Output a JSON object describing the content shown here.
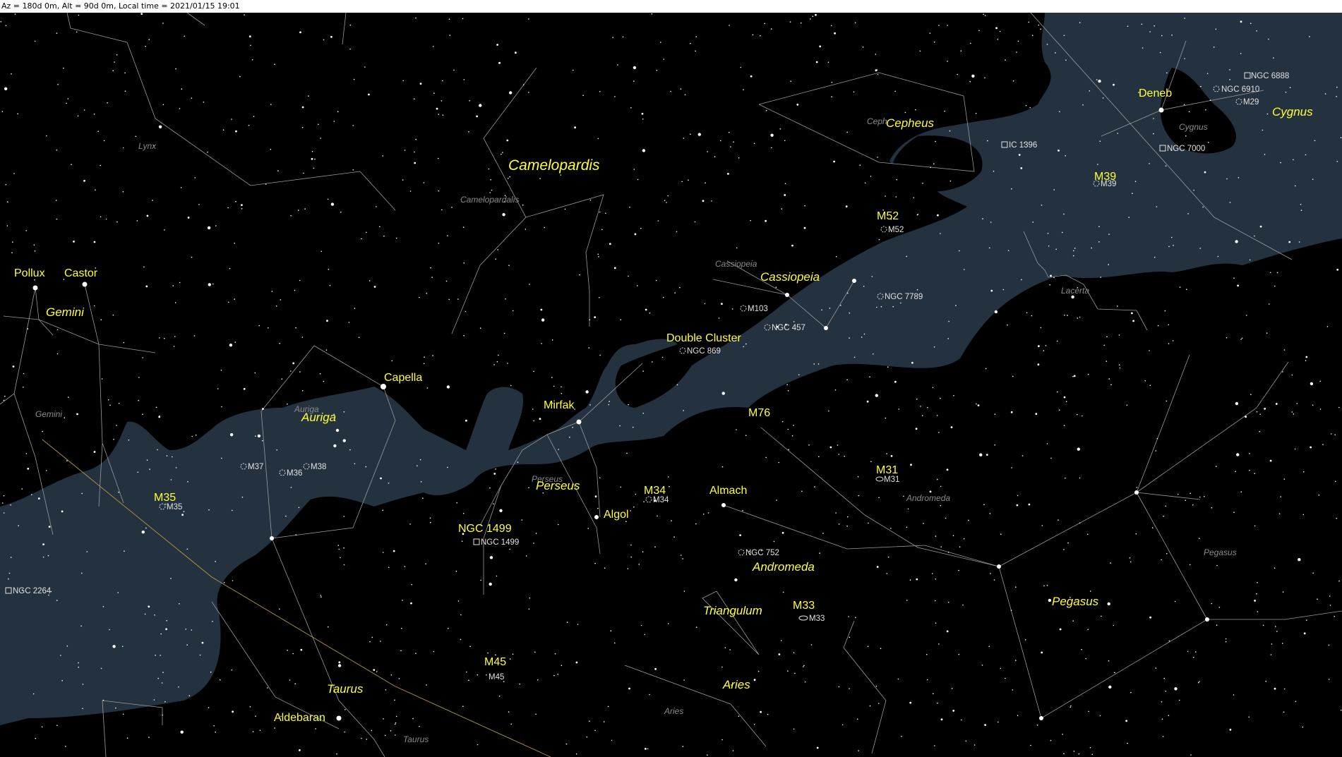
{
  "status": {
    "text": "Az = 180d 0m, Alt = 90d 0m, Local time = 2021/01/15 19:01"
  },
  "colors": {
    "sky": "#000000",
    "milky_way": "#243240",
    "label": "#ffff33",
    "constellation_line": "#9a9a9a",
    "ecliptic": "#b59a3a"
  },
  "star_labels": [
    {
      "id": "pollux",
      "text": "Pollux"
    },
    {
      "id": "castor",
      "text": "Castor"
    },
    {
      "id": "capella",
      "text": "Capella"
    },
    {
      "id": "mirfak",
      "text": "Mirfak"
    },
    {
      "id": "algol",
      "text": "Algol"
    },
    {
      "id": "almach",
      "text": "Almach"
    },
    {
      "id": "deneb",
      "text": "Deneb"
    },
    {
      "id": "aldebaran",
      "text": "Aldebaran"
    },
    {
      "id": "double-cluster",
      "text": "Double Cluster"
    },
    {
      "id": "m35",
      "text": "M35"
    },
    {
      "id": "m34",
      "text": "M34"
    },
    {
      "id": "m76",
      "text": "M76"
    },
    {
      "id": "m31",
      "text": "M31"
    },
    {
      "id": "m33",
      "text": "M33"
    },
    {
      "id": "m45",
      "text": "M45"
    },
    {
      "id": "m52",
      "text": "M52"
    },
    {
      "id": "m39",
      "text": "M39"
    },
    {
      "id": "ngc1499",
      "text": "NGC 1499"
    }
  ],
  "constellation_labels": [
    {
      "id": "camelopardis",
      "text": "Camelopardis",
      "size": "big"
    },
    {
      "id": "cepheus",
      "text": "Cepheus"
    },
    {
      "id": "cygnus",
      "text": "Cygnus"
    },
    {
      "id": "cassiopeia",
      "text": "Cassiopeia"
    },
    {
      "id": "gemini",
      "text": "Gemini"
    },
    {
      "id": "auriga",
      "text": "Auriga"
    },
    {
      "id": "perseus",
      "text": "Perseus"
    },
    {
      "id": "andromeda",
      "text": "Andromeda"
    },
    {
      "id": "triangulum",
      "text": "Triangulum"
    },
    {
      "id": "pegasus",
      "text": "Pegasus"
    },
    {
      "id": "aries",
      "text": "Aries"
    },
    {
      "id": "taurus",
      "text": "Taurus"
    }
  ],
  "boundary_labels": [
    {
      "id": "lynx",
      "text": "Lynx"
    },
    {
      "id": "camelopardalis",
      "text": "Camelopardalis"
    },
    {
      "id": "cepheus-b",
      "text": "Ceph"
    },
    {
      "id": "cygnus-b",
      "text": "Cygnus"
    },
    {
      "id": "cassiopeia-b",
      "text": "Cassiopeia"
    },
    {
      "id": "lacerta",
      "text": "Lacerta"
    },
    {
      "id": "gemini-b",
      "text": "Gemini"
    },
    {
      "id": "auriga-b",
      "text": "Auriga"
    },
    {
      "id": "perseus-b",
      "text": "Perseus"
    },
    {
      "id": "andromeda-b",
      "text": "Andromeda"
    },
    {
      "id": "pegasus-b",
      "text": "Pegasus"
    },
    {
      "id": "aries-b",
      "text": "Aries"
    },
    {
      "id": "taurus-b",
      "text": "Taurus"
    }
  ],
  "dso_labels": [
    {
      "id": "ngc6888",
      "text": "NGC 6888"
    },
    {
      "id": "ngc6910",
      "text": "NGC 6910"
    },
    {
      "id": "m29",
      "text": "M29"
    },
    {
      "id": "ic1396",
      "text": "IC 1396"
    },
    {
      "id": "ngc7000",
      "text": "NGC 7000"
    },
    {
      "id": "m39s",
      "text": "M39"
    },
    {
      "id": "m52s",
      "text": "M52"
    },
    {
      "id": "ngc7789",
      "text": "NGC 7789"
    },
    {
      "id": "m103",
      "text": "M103"
    },
    {
      "id": "ngc457",
      "text": "NGC 457"
    },
    {
      "id": "ngc869",
      "text": "NGC 869"
    },
    {
      "id": "m37",
      "text": "M37"
    },
    {
      "id": "m36",
      "text": "M36"
    },
    {
      "id": "m38",
      "text": "M38"
    },
    {
      "id": "m35s",
      "text": "M35"
    },
    {
      "id": "ngc2264",
      "text": "NGC 2264"
    },
    {
      "id": "ngc1499s",
      "text": "NGC 1499"
    },
    {
      "id": "m34s",
      "text": "M34"
    },
    {
      "id": "m31s",
      "text": "M31"
    },
    {
      "id": "ngc752",
      "text": "NGC 752"
    },
    {
      "id": "m33s",
      "text": "M33"
    },
    {
      "id": "m45s",
      "text": "M45"
    }
  ]
}
